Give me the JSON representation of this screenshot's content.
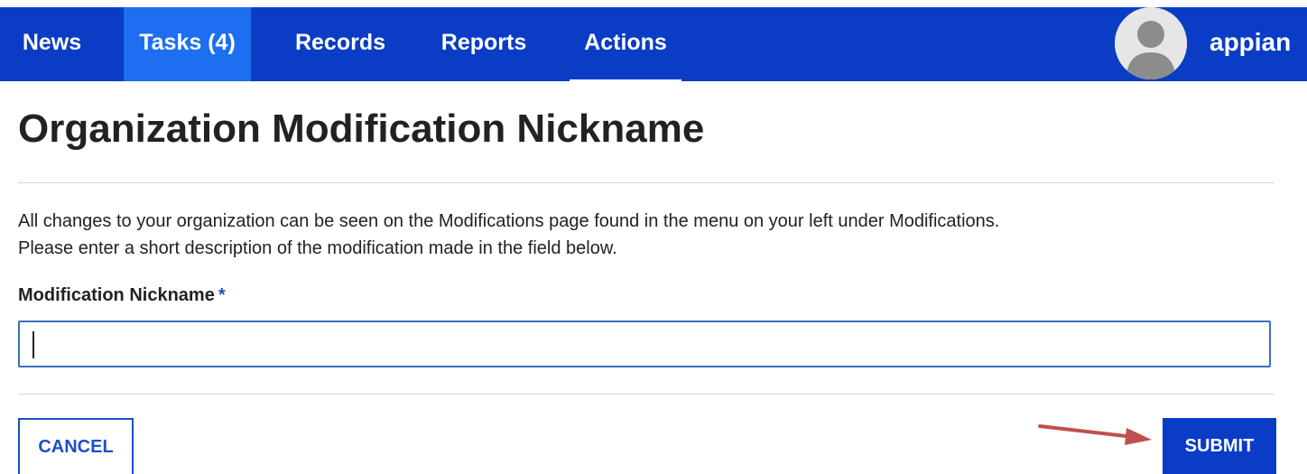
{
  "nav": {
    "tabs": [
      {
        "label": "News"
      },
      {
        "label": "Tasks (4)"
      },
      {
        "label": "Records"
      },
      {
        "label": "Reports"
      },
      {
        "label": "Actions"
      }
    ],
    "active_tab": "Actions",
    "highlighted_tab": "Tasks (4)",
    "brand": "appian",
    "avatar_icon": "user-avatar-icon"
  },
  "page": {
    "title": "Organization Modification Nickname",
    "description_line1": "All changes to your organization can be seen on the Modifications page found in the menu on your left under Modifications.",
    "description_line2": "Please enter a short description of the modification made in the field below."
  },
  "form": {
    "nickname_label": "Modification Nickname",
    "required_marker": "*",
    "nickname_value": ""
  },
  "buttons": {
    "cancel_label": "CANCEL",
    "submit_label": "SUBMIT"
  },
  "annotation": {
    "arrow_icon": "red-arrow-icon",
    "arrow_color": "#c0504d"
  },
  "colors": {
    "nav_background": "#0a3cc6",
    "nav_highlight": "#1d6ef0",
    "accent": "#1d4fc9"
  }
}
